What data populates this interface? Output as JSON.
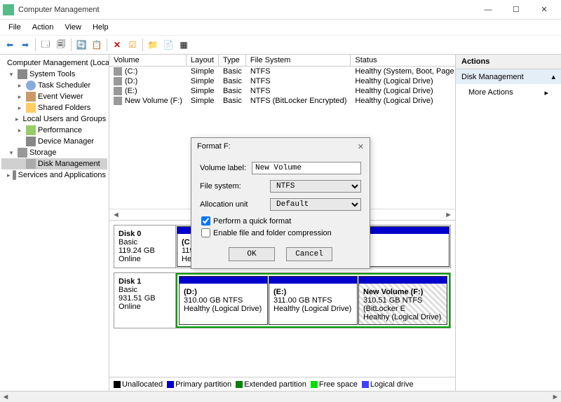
{
  "window": {
    "title": "Computer Management"
  },
  "menu": [
    "File",
    "Action",
    "View",
    "Help"
  ],
  "tree": {
    "root": "Computer Management (Local",
    "system_tools": "System Tools",
    "items_st": [
      "Task Scheduler",
      "Event Viewer",
      "Shared Folders",
      "Local Users and Groups",
      "Performance",
      "Device Manager"
    ],
    "storage": "Storage",
    "disk_mgmt": "Disk Management",
    "services": "Services and Applications"
  },
  "vol_headers": [
    "Volume",
    "Layout",
    "Type",
    "File System",
    "Status"
  ],
  "volumes": [
    {
      "name": "(C:)",
      "layout": "Simple",
      "type": "Basic",
      "fs": "NTFS",
      "status": "Healthy (System, Boot, Page File, Active, Prir"
    },
    {
      "name": "(D:)",
      "layout": "Simple",
      "type": "Basic",
      "fs": "NTFS",
      "status": "Healthy (Logical Drive)"
    },
    {
      "name": "(E:)",
      "layout": "Simple",
      "type": "Basic",
      "fs": "NTFS",
      "status": "Healthy (Logical Drive)"
    },
    {
      "name": "New Volume (F:)",
      "layout": "Simple",
      "type": "Basic",
      "fs": "NTFS (BitLocker Encrypted)",
      "status": "Healthy (Logical Drive)"
    }
  ],
  "disks": [
    {
      "label": "Disk 0",
      "type": "Basic",
      "size": "119.24 GB",
      "state": "Online",
      "parts": [
        {
          "name": "(C:)",
          "line2": "119.2",
          "line3": "Healthy"
        }
      ]
    },
    {
      "label": "Disk 1",
      "type": "Basic",
      "size": "931.51 GB",
      "state": "Online",
      "parts": [
        {
          "name": "(D:)",
          "line2": "310.00 GB NTFS",
          "line3": "Healthy (Logical Drive)"
        },
        {
          "name": "(E:)",
          "line2": "311.00 GB NTFS",
          "line3": "Healthy (Logical Drive)"
        },
        {
          "name": "New Volume   (F:)",
          "line2": "310.51 GB NTFS (BitLocker E",
          "line3": "Healthy (Logical Drive)"
        }
      ]
    }
  ],
  "legend": {
    "unalloc": "Unallocated",
    "primary": "Primary partition",
    "extended": "Extended partition",
    "free": "Free space",
    "logical": "Logical drive"
  },
  "actions": {
    "head": "Actions",
    "disk": "Disk Management",
    "more": "More Actions"
  },
  "dialog": {
    "title": "Format F:",
    "volume_label_lbl": "Volume label:",
    "volume_label_val": "New Volume",
    "fs_lbl": "File system:",
    "fs_val": "NTFS",
    "au_lbl": "Allocation unit",
    "au_val": "Default",
    "quick": "Perform a quick format",
    "compress": "Enable file and folder compression",
    "ok": "OK",
    "cancel": "Cancel"
  }
}
